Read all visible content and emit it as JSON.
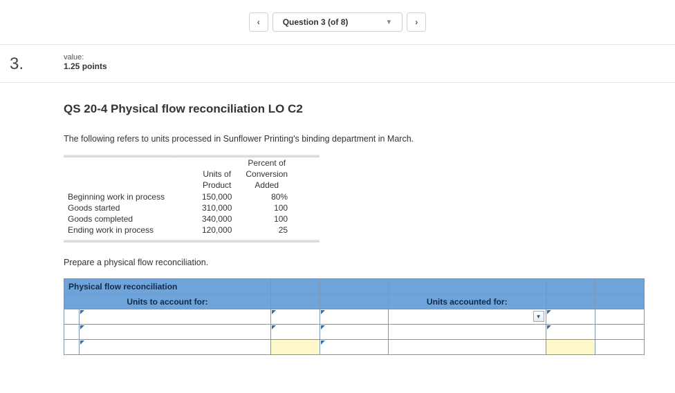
{
  "nav": {
    "prev_icon": "‹",
    "next_icon": "›",
    "label": "Question 3 (of 8)",
    "caret": "▼"
  },
  "question": {
    "number": "3.",
    "value_label": "value:",
    "points": "1.25 points",
    "title": "QS 20-4 Physical flow reconciliation LO C2",
    "intro": "The following refers to units processed in Sunflower Printing's binding department in March.",
    "instruction": "Prepare a physical flow reconciliation."
  },
  "data_table": {
    "col1": "Units of Product",
    "col2": "Percent of Conversion Added",
    "rows": [
      {
        "label": "Beginning work in process",
        "units": "150,000",
        "pct": "80%"
      },
      {
        "label": "Goods started",
        "units": "310,000",
        "pct": "100"
      },
      {
        "label": "Goods completed",
        "units": "340,000",
        "pct": "100"
      },
      {
        "label": "Ending work in process",
        "units": "120,000",
        "pct": "25"
      }
    ]
  },
  "answer": {
    "header": "Physical flow reconciliation",
    "left_hdr": "Units to account for:",
    "right_hdr": "Units accounted for:"
  }
}
